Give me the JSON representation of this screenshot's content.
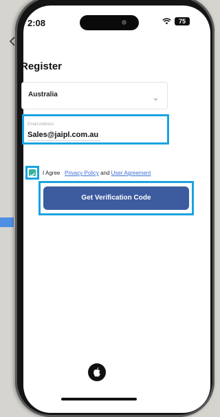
{
  "status_bar": {
    "time": "2:08",
    "battery": "75"
  },
  "page": {
    "title": "Register"
  },
  "form": {
    "country_value": "Australia",
    "email_label": "Email Address",
    "email_value": "Sales@jaipl.com.au"
  },
  "agreement": {
    "text_prefix": "I Agree",
    "privacy_link": "Privacy Policy",
    "conjunction": "and",
    "agreement_link": "User Agreement",
    "checked": true
  },
  "actions": {
    "verify_label": "Get Verification Code"
  },
  "icons": {
    "back": "chevron-left-icon",
    "dropdown": "chevron-down-icon",
    "wifi": "wifi-icon",
    "battery": "battery-icon",
    "apple": "apple-icon"
  },
  "colors": {
    "accent_blue": "#3d5b9f",
    "highlight": "#1aa3e0",
    "checkbox": "#39b29a",
    "link": "#3e6fd6"
  }
}
